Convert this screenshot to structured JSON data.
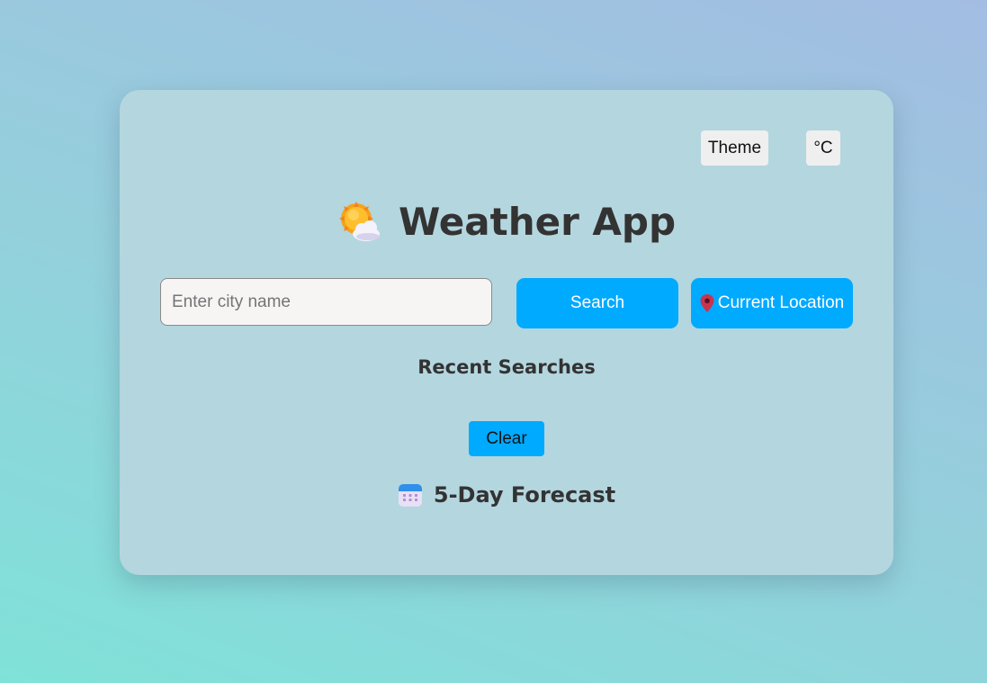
{
  "header": {
    "theme_label": "Theme",
    "unit_label": "°C"
  },
  "title": {
    "text": "Weather App",
    "icon": "sun-behind-cloud-icon"
  },
  "search": {
    "placeholder": "Enter city name",
    "value": "",
    "search_label": "Search",
    "location_label": "Current Location",
    "location_icon": "map-pin-icon"
  },
  "recent": {
    "title": "Recent Searches",
    "items": [],
    "clear_label": "Clear"
  },
  "forecast": {
    "title": "5-Day Forecast",
    "icon": "calendar-icon"
  },
  "colors": {
    "accent": "#00aaff",
    "card_bg": "#b4d6df",
    "text": "#333333"
  }
}
